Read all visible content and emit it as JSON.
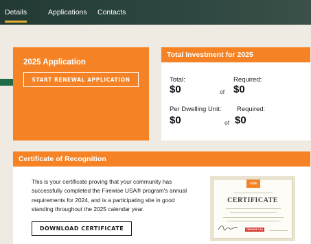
{
  "nav": {
    "tabs": [
      {
        "label": "Details",
        "active": true
      },
      {
        "label": "Applications",
        "active": false
      },
      {
        "label": "Contacts",
        "active": false
      }
    ],
    "accent_underline": "#e6b02e",
    "background": "#233a34"
  },
  "application": {
    "title": "2025 Application",
    "button_label": "START RENEWAL APPLICATION",
    "pointer_icon": "arrow-right-icon",
    "pointer_color": "#1e6b4a"
  },
  "investment": {
    "title": "Total Investment for 2025",
    "total_label": "Total:",
    "total_value": "$0",
    "total_of": "of",
    "total_required_label": "Required:",
    "total_required_value": "$0",
    "per_unit_label": "Per Dwelling Unit:",
    "per_unit_value": "$0",
    "per_unit_of": "of",
    "per_unit_required_label": "Required:",
    "per_unit_required_value": "$0"
  },
  "certificate": {
    "title": "Certificate of Recognition",
    "description": "This is your certificate proving that your community has successfully completed the Firewise USA® program's annual requirements for 2024, and is a participating site in good standing throughout the 2025 calendar year.",
    "button_label": "DOWNLOAD CERTIFICATE",
    "thumbnail": {
      "year": "2025",
      "heading": "CERTIFICATE",
      "logo_text": "FIREWISE USA"
    }
  },
  "colors": {
    "orange": "#f58326",
    "page_background": "#efebe2",
    "panel_background": "#ffffff"
  }
}
